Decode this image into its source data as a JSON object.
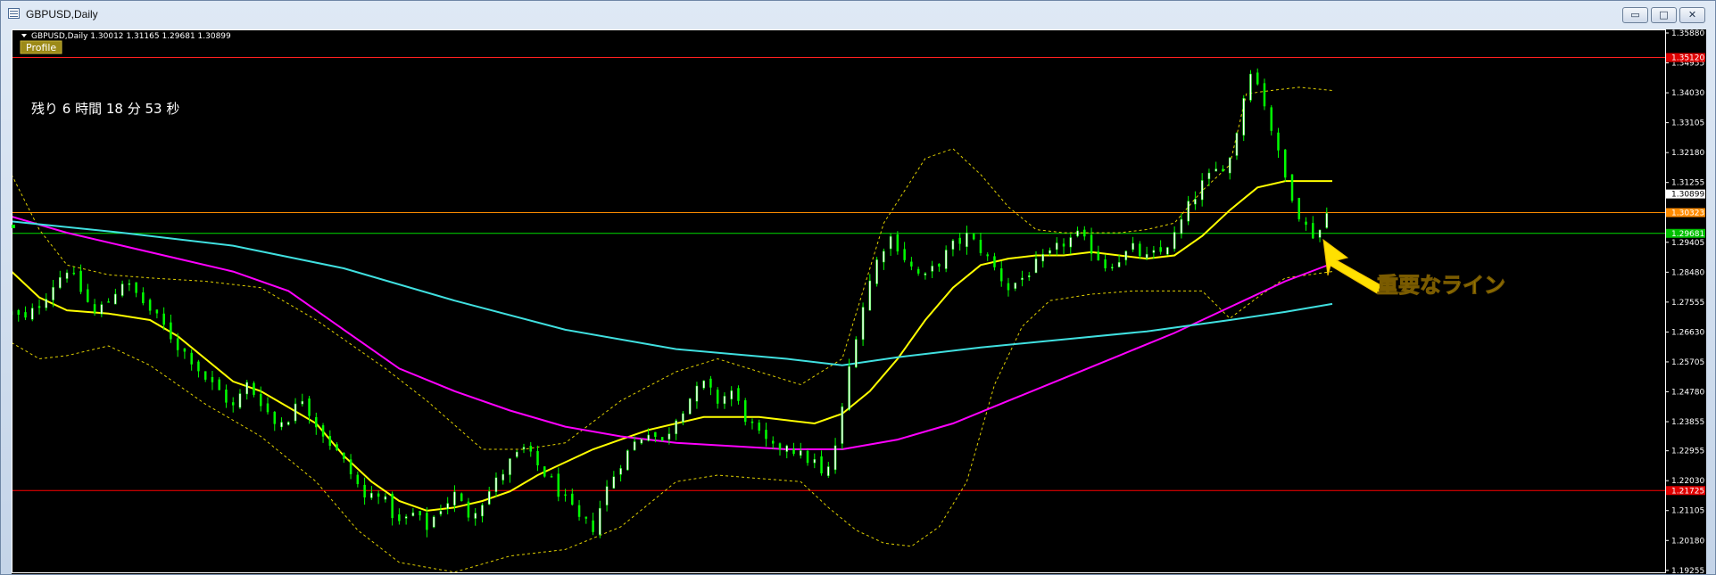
{
  "window": {
    "title": "GBPUSD,Daily",
    "buttons": {
      "minimize": "▭",
      "maximize": "□",
      "close": "✕"
    }
  },
  "header": {
    "symbol_info": "GBPUSD,Daily  1.30012 1.31165 1.29681 1.30899",
    "profile_label": "Profile"
  },
  "countdown": {
    "text": "残り 6 時間 18 分 53 秒"
  },
  "annotation": {
    "text": "重要なライン",
    "color": "#ffe000"
  },
  "colors": {
    "background": "#000000",
    "frame": "#ffffff",
    "bull_candle": "#ffffff",
    "bear_candle": "#00ff00",
    "sma_fast": "#ffff00",
    "sma_mid": "#ff00ff",
    "sma_slow": "#40e0e0",
    "bollinger": "#e0d000"
  },
  "chart_data": {
    "type": "candlestick",
    "ylim": [
      1.1925,
      1.3588
    ],
    "yticks": [
      "1.35880",
      "1.34955",
      "1.34030",
      "1.33105",
      "1.32180",
      "1.31255",
      "1.30330",
      "1.29405",
      "1.28480",
      "1.27555",
      "1.26630",
      "1.25705",
      "1.24780",
      "1.23855",
      "1.22955",
      "1.22030",
      "1.21105",
      "1.20180",
      "1.19255"
    ],
    "horizontal_lines": [
      {
        "price": 1.3512,
        "label": "1.35120",
        "color": "#ff2020",
        "label_bg": "#e00000"
      },
      {
        "price": 1.30323,
        "label": "1.30323",
        "color": "#ff8c00",
        "label_bg": "#ff8c00"
      },
      {
        "price": 1.29681,
        "label": "1.29681",
        "color": "#00dd00",
        "label_bg": "#00c000"
      },
      {
        "price": 1.21725,
        "label": "1.21725",
        "color": "#ff0000",
        "label_bg": "#e00000"
      }
    ],
    "current_price": {
      "price": 1.30899,
      "label": "1.30899"
    },
    "path_points": [
      [
        0,
        1.272
      ],
      [
        5,
        1.27
      ],
      [
        10,
        1.275
      ],
      [
        15,
        1.281
      ],
      [
        20,
        1.286
      ],
      [
        25,
        1.279
      ],
      [
        30,
        1.272
      ],
      [
        35,
        1.276
      ],
      [
        40,
        1.282
      ],
      [
        45,
        1.278
      ],
      [
        50,
        1.273
      ],
      [
        55,
        1.268
      ],
      [
        60,
        1.262
      ],
      [
        65,
        1.258
      ],
      [
        70,
        1.252
      ],
      [
        75,
        1.248
      ],
      [
        80,
        1.243
      ],
      [
        85,
        1.25
      ],
      [
        90,
        1.245
      ],
      [
        95,
        1.238
      ],
      [
        100,
        1.24
      ],
      [
        105,
        1.246
      ],
      [
        110,
        1.238
      ],
      [
        115,
        1.232
      ],
      [
        120,
        1.226
      ],
      [
        125,
        1.219
      ],
      [
        128,
        1.214
      ],
      [
        132,
        1.218
      ],
      [
        136,
        1.212
      ],
      [
        140,
        1.207
      ],
      [
        145,
        1.21
      ],
      [
        150,
        1.206
      ],
      [
        155,
        1.212
      ],
      [
        160,
        1.216
      ],
      [
        165,
        1.21
      ],
      [
        170,
        1.214
      ],
      [
        175,
        1.22
      ],
      [
        180,
        1.226
      ],
      [
        185,
        1.23
      ],
      [
        190,
        1.225
      ],
      [
        195,
        1.22
      ],
      [
        200,
        1.214
      ],
      [
        205,
        1.208
      ],
      [
        210,
        1.206
      ],
      [
        215,
        1.218
      ],
      [
        220,
        1.226
      ],
      [
        225,
        1.232
      ],
      [
        230,
        1.236
      ],
      [
        235,
        1.232
      ],
      [
        240,
        1.24
      ],
      [
        245,
        1.246
      ],
      [
        250,
        1.25
      ],
      [
        255,
        1.245
      ],
      [
        260,
        1.248
      ],
      [
        265,
        1.24
      ],
      [
        270,
        1.234
      ],
      [
        275,
        1.23
      ],
      [
        280,
        1.232
      ],
      [
        285,
        1.228
      ],
      [
        290,
        1.226
      ],
      [
        293,
        1.221
      ],
      [
        296,
        1.225
      ],
      [
        300,
        1.242
      ],
      [
        303,
        1.258
      ],
      [
        306,
        1.27
      ],
      [
        310,
        1.282
      ],
      [
        314,
        1.292
      ],
      [
        318,
        1.296
      ],
      [
        322,
        1.29
      ],
      [
        326,
        1.285
      ],
      [
        330,
        1.283
      ],
      [
        335,
        1.288
      ],
      [
        340,
        1.293
      ],
      [
        345,
        1.296
      ],
      [
        350,
        1.292
      ],
      [
        355,
        1.286
      ],
      [
        360,
        1.28
      ],
      [
        365,
        1.283
      ],
      [
        370,
        1.287
      ],
      [
        375,
        1.29
      ],
      [
        380,
        1.294
      ],
      [
        385,
        1.296
      ],
      [
        390,
        1.292
      ],
      [
        395,
        1.287
      ],
      [
        400,
        1.289
      ],
      [
        405,
        1.292
      ],
      [
        410,
        1.289
      ],
      [
        415,
        1.291
      ],
      [
        420,
        1.296
      ],
      [
        425,
        1.305
      ],
      [
        430,
        1.312
      ],
      [
        435,
        1.316
      ],
      [
        440,
        1.32
      ],
      [
        444,
        1.334
      ],
      [
        447,
        1.349
      ],
      [
        450,
        1.343
      ],
      [
        453,
        1.336
      ],
      [
        456,
        1.326
      ],
      [
        459,
        1.316
      ],
      [
        462,
        1.31
      ],
      [
        465,
        1.303
      ],
      [
        468,
        1.298
      ],
      [
        471,
        1.296
      ],
      [
        474,
        1.3
      ],
      [
        477,
        1.3089
      ]
    ],
    "series": [
      {
        "type": "line",
        "kind": "sma_fast",
        "points": [
          [
            0,
            1.285
          ],
          [
            10,
            1.277
          ],
          [
            20,
            1.273
          ],
          [
            35,
            1.272
          ],
          [
            50,
            1.27
          ],
          [
            60,
            1.265
          ],
          [
            70,
            1.258
          ],
          [
            80,
            1.251
          ],
          [
            90,
            1.248
          ],
          [
            100,
            1.243
          ],
          [
            110,
            1.238
          ],
          [
            120,
            1.228
          ],
          [
            130,
            1.22
          ],
          [
            140,
            1.214
          ],
          [
            150,
            1.211
          ],
          [
            160,
            1.212
          ],
          [
            170,
            1.214
          ],
          [
            180,
            1.217
          ],
          [
            190,
            1.222
          ],
          [
            200,
            1.226
          ],
          [
            210,
            1.23
          ],
          [
            220,
            1.233
          ],
          [
            230,
            1.236
          ],
          [
            240,
            1.238
          ],
          [
            250,
            1.24
          ],
          [
            260,
            1.24
          ],
          [
            270,
            1.24
          ],
          [
            280,
            1.239
          ],
          [
            290,
            1.238
          ],
          [
            300,
            1.241
          ],
          [
            310,
            1.248
          ],
          [
            320,
            1.258
          ],
          [
            330,
            1.27
          ],
          [
            340,
            1.28
          ],
          [
            350,
            1.287
          ],
          [
            360,
            1.289
          ],
          [
            370,
            1.29
          ],
          [
            380,
            1.29
          ],
          [
            390,
            1.291
          ],
          [
            400,
            1.29
          ],
          [
            410,
            1.289
          ],
          [
            420,
            1.29
          ],
          [
            430,
            1.296
          ],
          [
            440,
            1.304
          ],
          [
            450,
            1.311
          ],
          [
            460,
            1.313
          ],
          [
            470,
            1.313
          ],
          [
            477,
            1.313
          ]
        ]
      },
      {
        "type": "line",
        "kind": "sma_mid",
        "points": [
          [
            0,
            1.302
          ],
          [
            20,
            1.297
          ],
          [
            40,
            1.293
          ],
          [
            60,
            1.289
          ],
          [
            80,
            1.285
          ],
          [
            100,
            1.279
          ],
          [
            120,
            1.267
          ],
          [
            140,
            1.255
          ],
          [
            160,
            1.248
          ],
          [
            180,
            1.242
          ],
          [
            200,
            1.237
          ],
          [
            220,
            1.234
          ],
          [
            240,
            1.232
          ],
          [
            260,
            1.231
          ],
          [
            280,
            1.23
          ],
          [
            300,
            1.23
          ],
          [
            320,
            1.233
          ],
          [
            340,
            1.238
          ],
          [
            360,
            1.245
          ],
          [
            380,
            1.252
          ],
          [
            400,
            1.259
          ],
          [
            420,
            1.266
          ],
          [
            440,
            1.274
          ],
          [
            460,
            1.282
          ],
          [
            477,
            1.2875
          ]
        ]
      },
      {
        "type": "line",
        "kind": "sma_slow",
        "points": [
          [
            0,
            1.3005
          ],
          [
            40,
            1.297
          ],
          [
            80,
            1.293
          ],
          [
            120,
            1.286
          ],
          [
            160,
            1.276
          ],
          [
            200,
            1.267
          ],
          [
            240,
            1.261
          ],
          [
            280,
            1.258
          ],
          [
            300,
            1.256
          ],
          [
            320,
            1.2585
          ],
          [
            350,
            1.2615
          ],
          [
            380,
            1.264
          ],
          [
            410,
            1.2665
          ],
          [
            440,
            1.27
          ],
          [
            460,
            1.2725
          ],
          [
            477,
            1.275
          ]
        ]
      },
      {
        "type": "line",
        "kind": "bollinger",
        "points": [
          [
            0,
            1.315
          ],
          [
            10,
            1.298
          ],
          [
            20,
            1.287
          ],
          [
            35,
            1.284
          ],
          [
            50,
            1.283
          ],
          [
            70,
            1.282
          ],
          [
            90,
            1.28
          ],
          [
            110,
            1.27
          ],
          [
            120,
            1.264
          ],
          [
            135,
            1.255
          ],
          [
            150,
            1.245
          ],
          [
            170,
            1.23
          ],
          [
            185,
            1.23
          ],
          [
            200,
            1.232
          ],
          [
            220,
            1.245
          ],
          [
            240,
            1.254
          ],
          [
            255,
            1.258
          ],
          [
            270,
            1.254
          ],
          [
            285,
            1.25
          ],
          [
            300,
            1.258
          ],
          [
            315,
            1.3
          ],
          [
            330,
            1.32
          ],
          [
            340,
            1.323
          ],
          [
            350,
            1.315
          ],
          [
            360,
            1.305
          ],
          [
            370,
            1.298
          ],
          [
            380,
            1.297
          ],
          [
            390,
            1.297
          ],
          [
            400,
            1.297
          ],
          [
            410,
            1.298
          ],
          [
            420,
            1.3
          ],
          [
            430,
            1.31
          ],
          [
            440,
            1.318
          ],
          [
            446,
            1.34
          ],
          [
            455,
            1.341
          ],
          [
            465,
            1.342
          ],
          [
            477,
            1.341
          ]
        ]
      },
      {
        "type": "line",
        "kind": "bollinger",
        "points": [
          [
            0,
            1.263
          ],
          [
            10,
            1.258
          ],
          [
            20,
            1.259
          ],
          [
            35,
            1.262
          ],
          [
            50,
            1.256
          ],
          [
            70,
            1.244
          ],
          [
            90,
            1.234
          ],
          [
            110,
            1.22
          ],
          [
            125,
            1.205
          ],
          [
            140,
            1.195
          ],
          [
            160,
            1.192
          ],
          [
            180,
            1.197
          ],
          [
            200,
            1.199
          ],
          [
            220,
            1.206
          ],
          [
            240,
            1.22
          ],
          [
            255,
            1.222
          ],
          [
            270,
            1.221
          ],
          [
            285,
            1.22
          ],
          [
            295,
            1.212
          ],
          [
            305,
            1.205
          ],
          [
            315,
            1.201
          ],
          [
            325,
            1.2
          ],
          [
            335,
            1.206
          ],
          [
            345,
            1.22
          ],
          [
            355,
            1.25
          ],
          [
            365,
            1.268
          ],
          [
            375,
            1.276
          ],
          [
            390,
            1.278
          ],
          [
            405,
            1.279
          ],
          [
            420,
            1.279
          ],
          [
            430,
            1.279
          ],
          [
            440,
            1.2705
          ],
          [
            450,
            1.277
          ],
          [
            460,
            1.283
          ],
          [
            477,
            1.285
          ]
        ]
      }
    ]
  }
}
